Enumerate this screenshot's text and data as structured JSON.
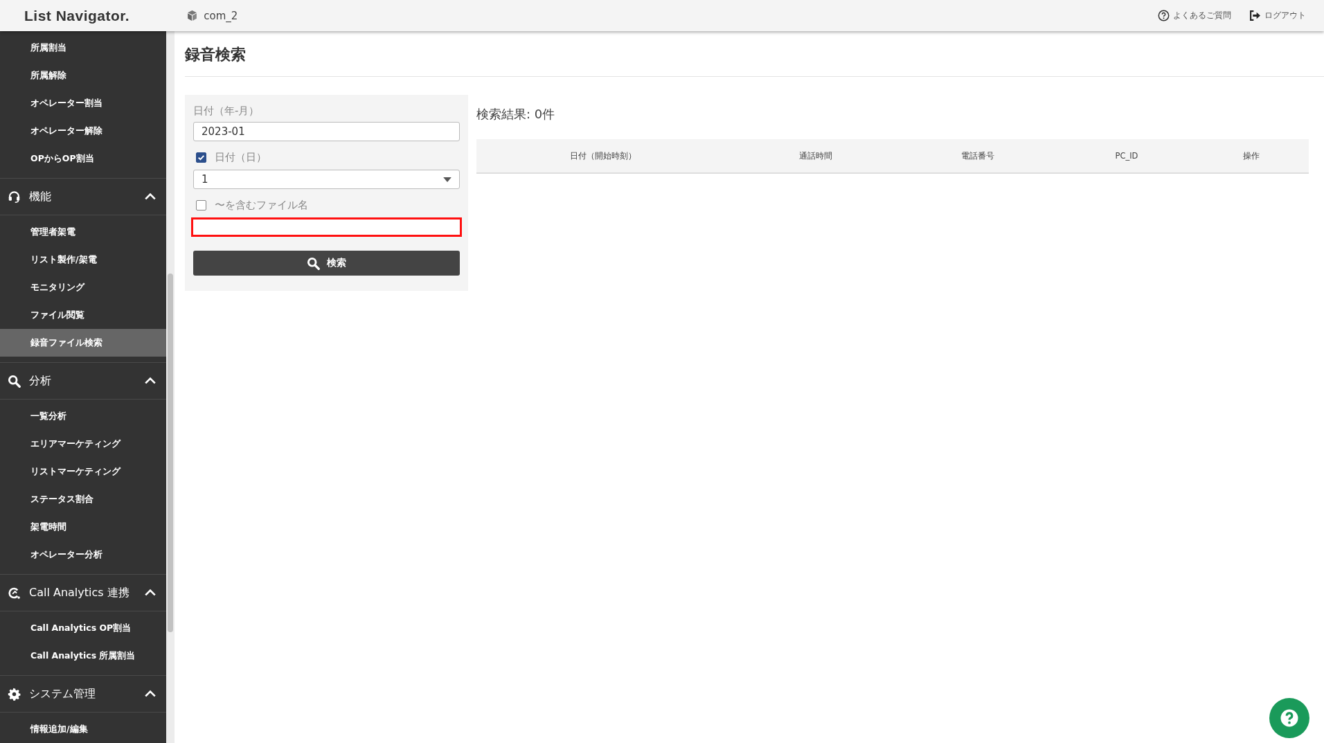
{
  "header": {
    "logo": "List Navigator.",
    "company": "com_2",
    "links": [
      {
        "kind": "faq",
        "label": "よくあるご質問"
      },
      {
        "kind": "logout",
        "label": "ログアウト"
      }
    ]
  },
  "sidebar": {
    "sections": [
      {
        "items": [
          {
            "label": "所属割当",
            "selected": false
          },
          {
            "label": "所属解除",
            "selected": false
          },
          {
            "label": "オペレーター割当",
            "selected": false
          },
          {
            "label": "オペレーター解除",
            "selected": false
          },
          {
            "label": "OPからOP割当",
            "selected": false
          }
        ]
      },
      {
        "title": "機能",
        "expanded": true,
        "items": [
          {
            "label": "管理者架電",
            "selected": false
          },
          {
            "label": "リスト製作/架電",
            "selected": false
          },
          {
            "label": "モニタリング",
            "selected": false
          },
          {
            "label": "ファイル閲覧",
            "selected": false
          },
          {
            "label": "録音ファイル検索",
            "selected": true
          }
        ]
      },
      {
        "title": "分析",
        "expanded": true,
        "items": [
          {
            "label": "一覧分析",
            "selected": false
          },
          {
            "label": "エリアマーケティング",
            "selected": false
          },
          {
            "label": "リストマーケティング",
            "selected": false
          },
          {
            "label": "ステータス割合",
            "selected": false
          },
          {
            "label": "架電時間",
            "selected": false
          },
          {
            "label": "オペレーター分析",
            "selected": false
          }
        ]
      },
      {
        "title": "Call Analytics 連携",
        "expanded": true,
        "items": [
          {
            "label": "Call Analytics OP割当",
            "selected": false
          },
          {
            "label": "Call Analytics 所属割当",
            "selected": false
          }
        ]
      },
      {
        "title": "システム管理",
        "expanded": true,
        "items": [
          {
            "label": "情報追加/編集",
            "selected": false
          }
        ]
      }
    ]
  },
  "page_title": "録音検索",
  "form": {
    "month_label": "日付（年-月）",
    "month_value": "2023-01",
    "day": {
      "label": "日付（日）",
      "checked": true,
      "value": "1"
    },
    "filename": {
      "label": "〜を含むファイル名",
      "checked": false,
      "highlighted": true
    },
    "search_button": "検索"
  },
  "results": {
    "summary": "検索結果: 0件",
    "columns": [
      "日付（開始時刻）",
      "通話時間",
      "電話番号",
      "PC_ID",
      "操作"
    ]
  }
}
